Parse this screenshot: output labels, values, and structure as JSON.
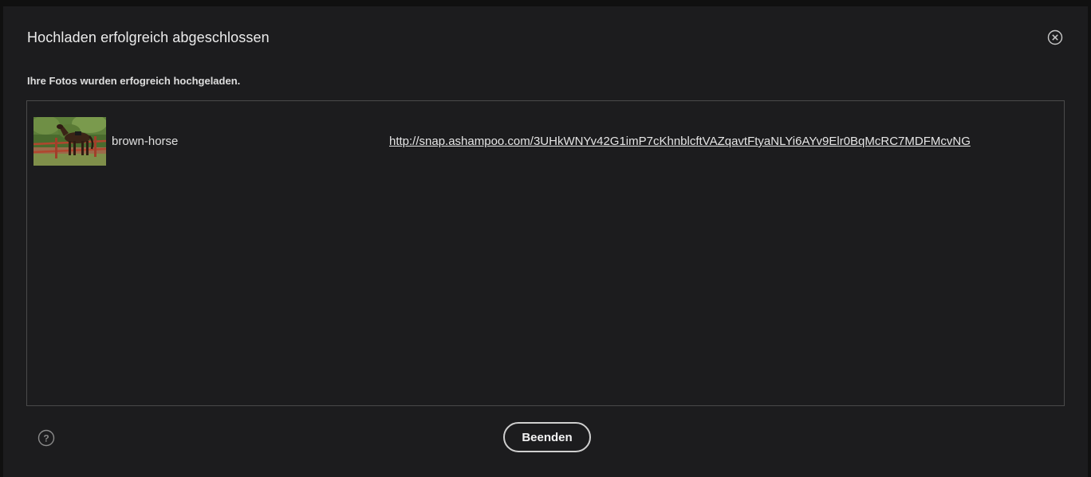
{
  "dialog": {
    "title": "Hochladen erfolgreich abgeschlossen",
    "subtitle": "Ihre Fotos wurden erfogreich hochgeladen.",
    "close_icon": "close-circle-icon",
    "help_icon": "help-circle-icon",
    "finish_label": "Beenden"
  },
  "uploads": [
    {
      "thumbnail": "brown-horse-photo",
      "name": "brown-horse",
      "url": "http://snap.ashampoo.com/3UHkWNYv42G1imP7cKhnblcftVAZqavtFtyaNLYi6AYv9Elr0BqMcRC7MDFMcvNG"
    }
  ]
}
